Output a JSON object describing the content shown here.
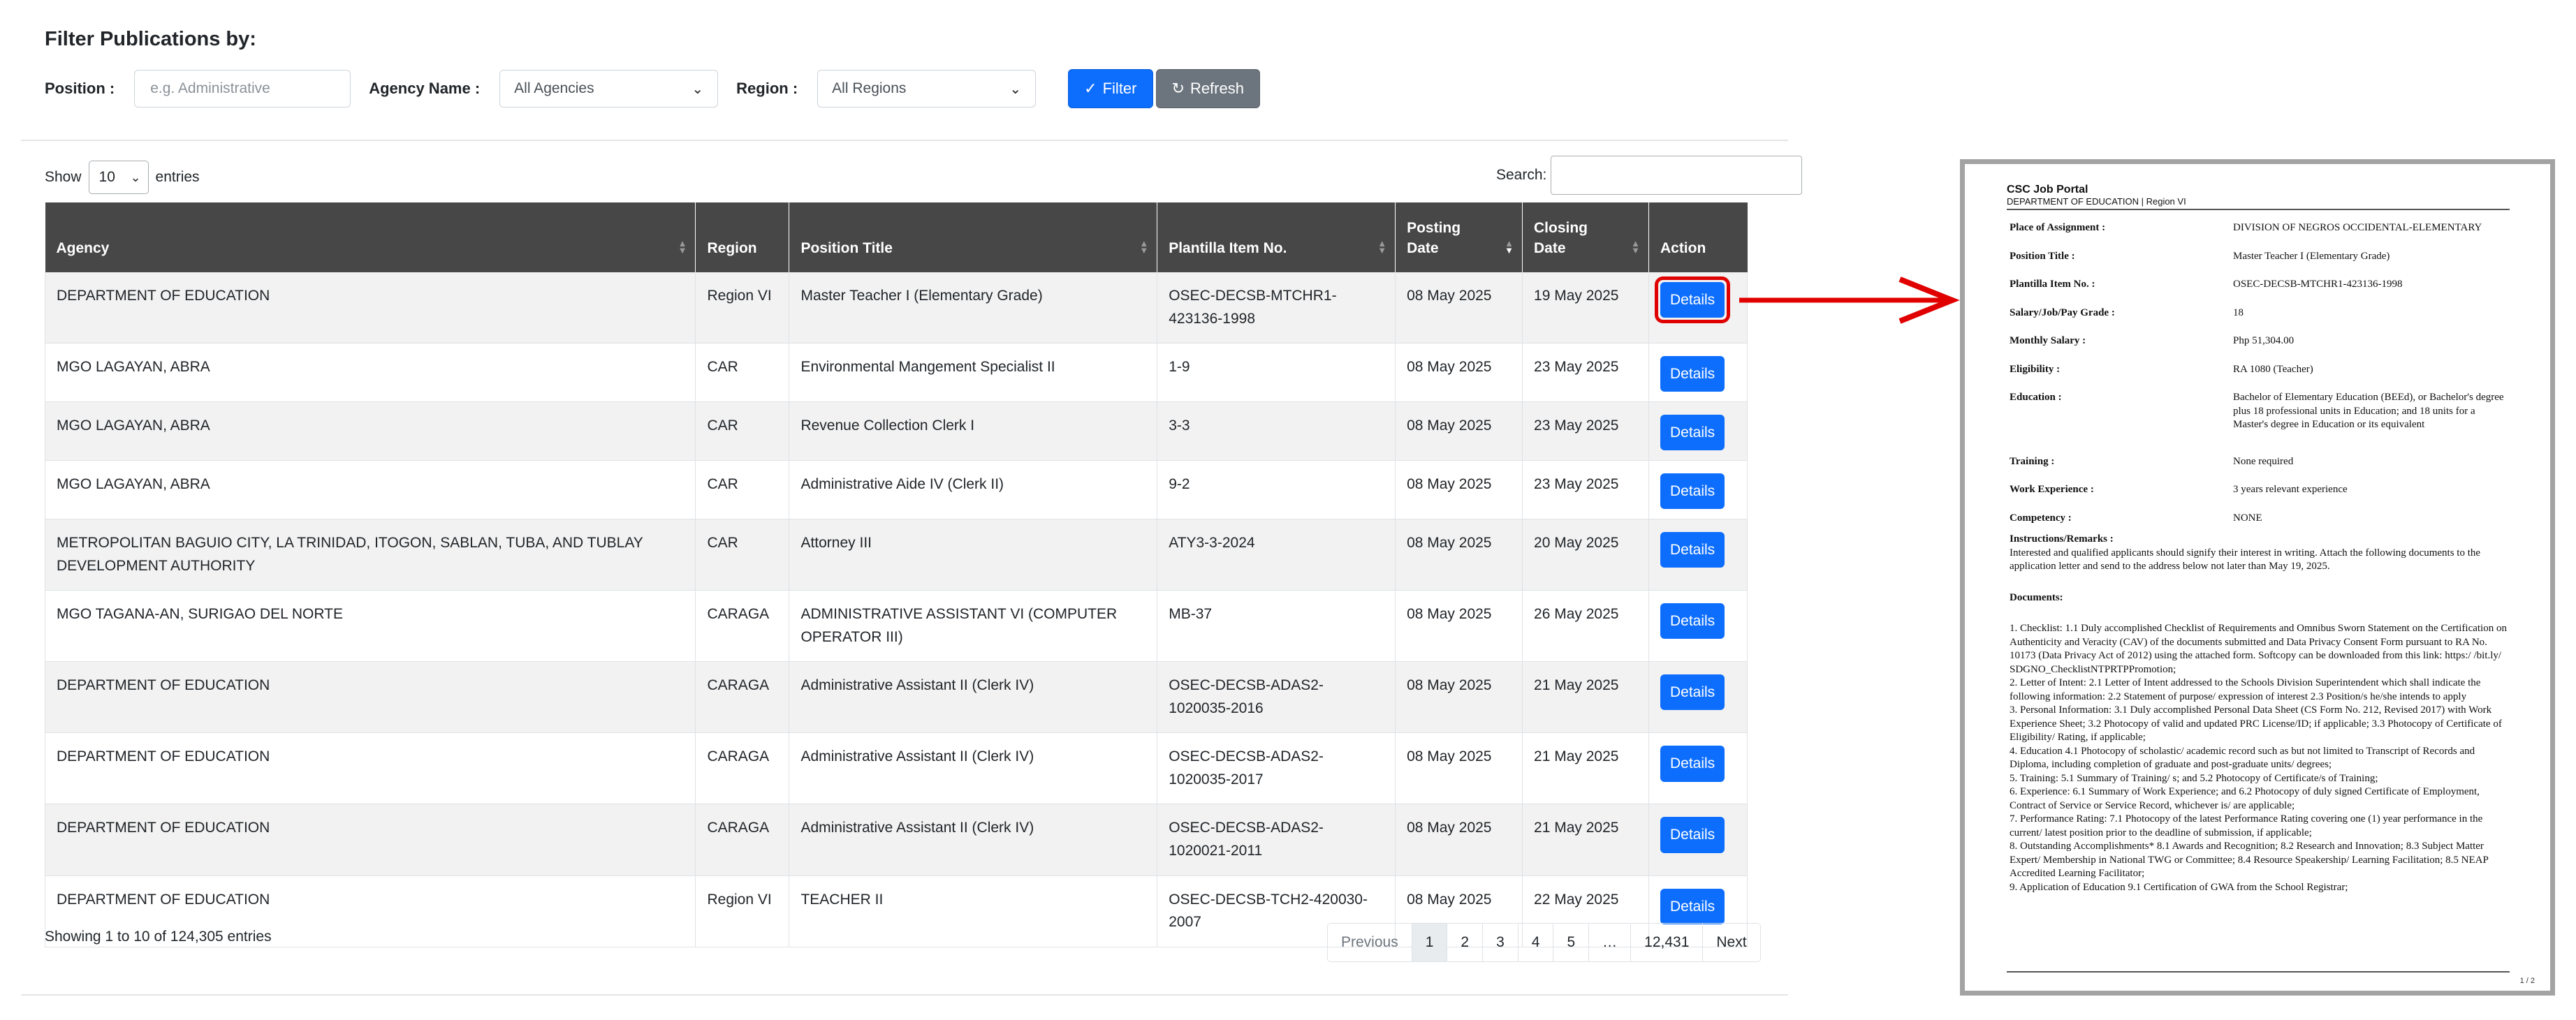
{
  "filter": {
    "title": "Filter Publications by:",
    "position_label": "Position :",
    "position_placeholder": "e.g. Administrative",
    "agency_label": "Agency Name :",
    "agency_value": "All Agencies",
    "region_label": "Region :",
    "region_value": "All Regions",
    "filter_button": "Filter",
    "refresh_button": "Refresh"
  },
  "table_controls": {
    "show_label": "Show",
    "entries_value": "10",
    "entries_label": "entries",
    "search_label": "Search:"
  },
  "table": {
    "headers": [
      "Agency",
      "Region",
      "Position Title",
      "Plantilla Item No.",
      "Posting Date",
      "Closing Date",
      "Action"
    ],
    "rows": [
      {
        "agency": "DEPARTMENT OF EDUCATION",
        "region": "Region VI",
        "position": "Master Teacher I (Elementary Grade)",
        "item": "OSEC-DECSB-MTCHR1-423136-1998",
        "posting": "08 May 2025",
        "closing": "19 May 2025",
        "action": "Details"
      },
      {
        "agency": "MGO LAGAYAN, ABRA",
        "region": "CAR",
        "position": "Environmental Mangement Specialist II",
        "item": "1-9",
        "posting": "08 May 2025",
        "closing": "23 May 2025",
        "action": "Details"
      },
      {
        "agency": "MGO LAGAYAN, ABRA",
        "region": "CAR",
        "position": "Revenue Collection Clerk I",
        "item": "3-3",
        "posting": "08 May 2025",
        "closing": "23 May 2025",
        "action": "Details"
      },
      {
        "agency": "MGO LAGAYAN, ABRA",
        "region": "CAR",
        "position": "Administrative Aide IV (Clerk II)",
        "item": "9-2",
        "posting": "08 May 2025",
        "closing": "23 May 2025",
        "action": "Details"
      },
      {
        "agency": "METROPOLITAN BAGUIO CITY, LA TRINIDAD, ITOGON, SABLAN, TUBA, AND TUBLAY DEVELOPMENT AUTHORITY",
        "region": "CAR",
        "position": "Attorney III",
        "item": "ATY3-3-2024",
        "posting": "08 May 2025",
        "closing": "20 May 2025",
        "action": "Details"
      },
      {
        "agency": "MGO TAGANA-AN, SURIGAO DEL NORTE",
        "region": "CARAGA",
        "position": "ADMINISTRATIVE ASSISTANT VI (COMPUTER OPERATOR III)",
        "item": "MB-37",
        "posting": "08 May 2025",
        "closing": "26 May 2025",
        "action": "Details"
      },
      {
        "agency": "DEPARTMENT OF EDUCATION",
        "region": "CARAGA",
        "position": "Administrative Assistant II (Clerk IV)",
        "item": "OSEC-DECSB-ADAS2-1020035-2016",
        "posting": "08 May 2025",
        "closing": "21 May 2025",
        "action": "Details"
      },
      {
        "agency": "DEPARTMENT OF EDUCATION",
        "region": "CARAGA",
        "position": "Administrative Assistant II (Clerk IV)",
        "item": "OSEC-DECSB-ADAS2-1020035-2017",
        "posting": "08 May 2025",
        "closing": "21 May 2025",
        "action": "Details"
      },
      {
        "agency": "DEPARTMENT OF EDUCATION",
        "region": "CARAGA",
        "position": "Administrative Assistant II (Clerk IV)",
        "item": "OSEC-DECSB-ADAS2-1020021-2011",
        "posting": "08 May 2025",
        "closing": "21 May 2025",
        "action": "Details"
      },
      {
        "agency": "DEPARTMENT OF EDUCATION",
        "region": "Region VI",
        "position": "TEACHER II",
        "item": "OSEC-DECSB-TCH2-420030-2007",
        "posting": "08 May 2025",
        "closing": "22 May 2025",
        "action": "Details"
      }
    ]
  },
  "footer": {
    "showing": "Showing 1 to 10 of 124,305 entries",
    "pagination": [
      "Previous",
      "1",
      "2",
      "3",
      "4",
      "5",
      "…",
      "12,431",
      "Next"
    ]
  },
  "document": {
    "portal": "CSC Job Portal",
    "subheader": "DEPARTMENT OF EDUCATION | Region VI",
    "fields": [
      {
        "k": "Place of Assignment :",
        "v": "DIVISION OF NEGROS OCCIDENTAL-ELEMENTARY"
      },
      {
        "k": "Position Title :",
        "v": "Master Teacher I (Elementary Grade)"
      },
      {
        "k": "Plantilla Item No. :",
        "v": "OSEC-DECSB-MTCHR1-423136-1998"
      },
      {
        "k": "Salary/Job/Pay Grade :",
        "v": "18"
      },
      {
        "k": "Monthly Salary :",
        "v": "Php 51,304.00"
      },
      {
        "k": "Eligibility :",
        "v": "RA 1080 (Teacher)"
      },
      {
        "k": "Education :",
        "v": "Bachelor of Elementary Education (BEEd), or Bachelor's degree plus 18 professional units in Education; and 18 units for a Master's degree in Education or its equivalent"
      },
      {
        "k": "Training :",
        "v": "None required"
      },
      {
        "k": "Work Experience :",
        "v": "3 years relevant experience"
      },
      {
        "k": "Competency :",
        "v": "NONE"
      }
    ],
    "instructions_label": "Instructions/Remarks :",
    "instructions_text": "Interested and qualified applicants should signify their interest in writing. Attach the following documents to the application letter and send to the address below not later than May 19, 2025.",
    "documents_label": "Documents:",
    "documents": [
      "1. Checklist: 1.1 Duly accomplished Checklist of Requirements and Omnibus Sworn Statement on the Certification on Authenticity and Veracity (CAV) of the documents submitted and Data Privacy Consent Form pursuant to RA No. 10173 (Data Privacy Act of 2012) using the attached form. Softcopy can be downloaded from this link: https:/ /bit.ly/ SDGNO_ChecklistNTPRTPPromotion;",
      "2. Letter of Intent: 2.1 Letter of Intent addressed to the Schools Division Superintendent which shall indicate the following information: 2.2 Statement of purpose/ expression of interest 2.3 Position/s he/she intends to apply",
      "3. Personal Information: 3.1 Duly accomplished Personal Data Sheet (CS Form No. 212, Revised 2017) with Work Experience Sheet; 3.2 Photocopy of valid and updated PRC License/ID; if applicable; 3.3 Photocopy of Certificate of Eligibility/ Rating, if applicable;",
      "4. Education 4.1 Photocopy of scholastic/ academic record such as but not limited to Transcript of Records and Diploma, including completion of graduate and post-graduate units/ degrees;",
      "5. Training: 5.1 Summary of Training/ s; and 5.2 Photocopy of Certificate/s of Training;",
      "6. Experience: 6.1 Summary of Work Experience; and 6.2 Photocopy of duly signed Certificate of Employment, Contract of Service or Service Record, whichever is/ are applicable;",
      "7. Performance Rating: 7.1 Photocopy of the latest Performance Rating covering one (1) year performance in the current/ latest position prior to the deadline of submission, if applicable;",
      "8. Outstanding Accomplishments* 8.1 Awards and Recognition; 8.2 Research and Innovation; 8.3 Subject Matter Expert/ Membership in National TWG or Committee; 8.4 Resource Speakership/ Learning Facilitation; 8.5 NEAP Accredited Learning Facilitator;",
      "9. Application of Education 9.1 Certification of GWA from the School Registrar;"
    ],
    "page_number": "1 / 2"
  },
  "colors": {
    "primary": "#0d6efd",
    "secondary": "#6c757d",
    "header_bg": "#474747",
    "highlight_red": "#e00000"
  }
}
